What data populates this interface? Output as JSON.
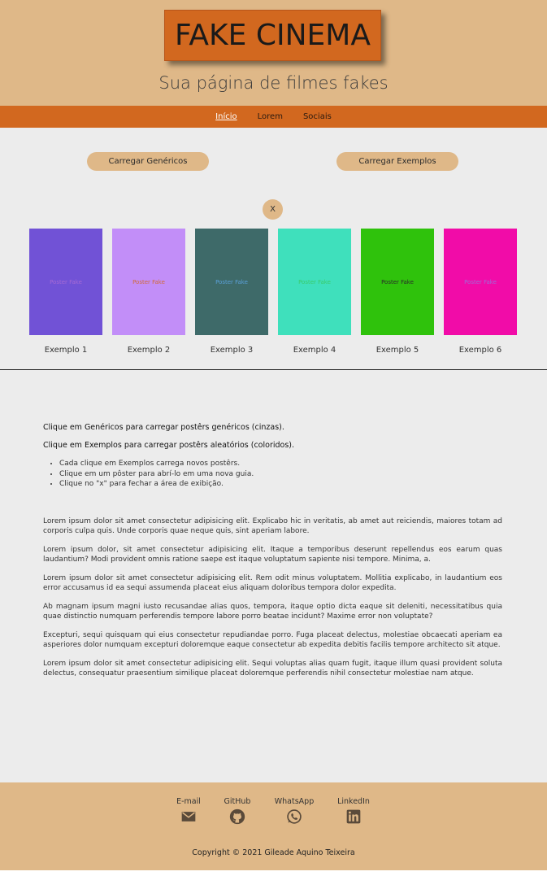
{
  "header": {
    "logo": "FAKE CINEMA",
    "subtitle": "Sua página de filmes fakes"
  },
  "nav": {
    "items": [
      {
        "label": "Início",
        "active": true
      },
      {
        "label": "Lorem",
        "active": false
      },
      {
        "label": "Sociais",
        "active": false
      }
    ]
  },
  "controls": {
    "load_generic": "Carregar Genéricos",
    "load_examples": "Carregar Exemplos",
    "close": "X"
  },
  "posters": [
    {
      "caption": "Exemplo 1",
      "text": "Poster Fake",
      "bg": "#7152d6",
      "fg": "#a66ad4"
    },
    {
      "caption": "Exemplo 2",
      "text": "Poster Fake",
      "bg": "#c28ef8",
      "fg": "#d06a3a"
    },
    {
      "caption": "Exemplo 3",
      "text": "Poster Fake",
      "bg": "#3e6a69",
      "fg": "#5aa0d8"
    },
    {
      "caption": "Exemplo 4",
      "text": "Poster Fake",
      "bg": "#3fe0bc",
      "fg": "#3acb6a"
    },
    {
      "caption": "Exemplo 5",
      "text": "Poster Fake",
      "bg": "#2fc20c",
      "fg": "#2a2a2a"
    },
    {
      "caption": "Exemplo 6",
      "text": "Poster Fake",
      "bg": "#f10ca8",
      "fg": "#a06ad8"
    }
  ],
  "info": {
    "line1": "Clique em Genéricos para carregar postêrs genéricos (cinzas).",
    "line2": "Clique em Exemplos para carregar postêrs aleatórios (coloridos).",
    "bullets": [
      "Cada clique em Exemplos carrega novos postêrs.",
      "Clique em um pôster para abrí-lo em uma nova guia.",
      "Clique no \"x\" para fechar a área de exibição."
    ]
  },
  "lorem": [
    "Lorem ipsum dolor sit amet consectetur adipisicing elit. Explicabo hic in veritatis, ab amet aut reiciendis, maiores totam ad corporis culpa quis. Unde corporis quae neque quis, sint aperiam labore.",
    "Lorem ipsum dolor, sit amet consectetur adipisicing elit. Itaque a temporibus deserunt repellendus eos earum quas laudantium? Modi provident omnis ratione saepe est itaque voluptatum sapiente nisi tempore. Minima, a.",
    "Lorem ipsum dolor sit amet consectetur adipisicing elit. Rem odit minus voluptatem. Mollitia explicabo, in laudantium eos error accusamus id ea sequi assumenda placeat eius aliquam doloribus tempora dolor expedita.",
    "Ab magnam ipsum magni iusto recusandae alias quos, tempora, itaque optio dicta eaque sit deleniti, necessitatibus quia quae distinctio numquam perferendis tempore labore porro beatae incidunt? Maxime error non voluptate?",
    "Excepturi, sequi quisquam qui eius consectetur repudiandae porro. Fuga placeat delectus, molestiae obcaecati aperiam ea asperiores dolor numquam excepturi doloremque eaque consectetur ab expedita debitis facilis tempore architecto sit atque.",
    "Lorem ipsum dolor sit amet consectetur adipisicing elit. Sequi voluptas alias quam fugit, itaque illum quasi provident soluta delectus, consequatur praesentium similique placeat doloremque perferendis nihil consectetur molestiae nam atque."
  ],
  "footer": {
    "social": [
      {
        "label": "E-mail",
        "icon": "email-icon"
      },
      {
        "label": "GitHub",
        "icon": "github-icon"
      },
      {
        "label": "WhatsApp",
        "icon": "whatsapp-icon"
      },
      {
        "label": "LinkedIn",
        "icon": "linkedin-icon"
      }
    ],
    "copyright": "Copyright © 2021 Gileade Aquino Teixeira"
  },
  "colors": {
    "accent": "#d2681f",
    "sand": "#dfb888",
    "background": "#ececec"
  }
}
